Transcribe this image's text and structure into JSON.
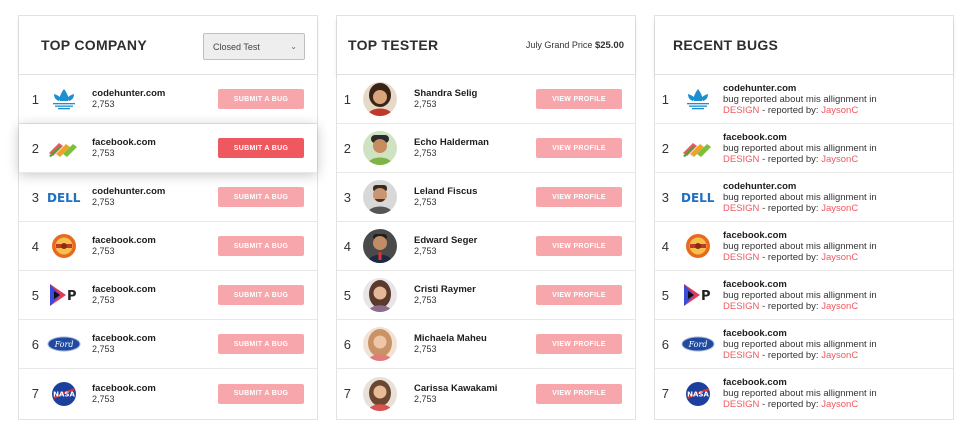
{
  "company": {
    "title": "TOP COMPANY",
    "filter": "Closed Test",
    "button_label": "SUBMIT A BUG",
    "rows": [
      {
        "rank": "1",
        "name": "codehunter.com",
        "count": "2,753",
        "logo": "adidas-logo-icon"
      },
      {
        "rank": "2",
        "name": "facebook.com",
        "count": "2,753",
        "logo": "stripes-logo-icon"
      },
      {
        "rank": "3",
        "name": "codehunter.com",
        "count": "2,753",
        "logo": "dell-logo-icon"
      },
      {
        "rank": "4",
        "name": "facebook.com",
        "count": "2,753",
        "logo": "badge-logo-icon"
      },
      {
        "rank": "5",
        "name": "facebook.com",
        "count": "2,753",
        "logo": "p-logo-icon"
      },
      {
        "rank": "6",
        "name": "facebook.com",
        "count": "2,753",
        "logo": "ford-logo-icon"
      },
      {
        "rank": "7",
        "name": "facebook.com",
        "count": "2,753",
        "logo": "nasa-logo-icon"
      }
    ]
  },
  "tester": {
    "title": "TOP TESTER",
    "prize_label": "July Grand Price",
    "prize_value": "$25.00",
    "button_label": "VIEW PROFILE",
    "rows": [
      {
        "rank": "1",
        "name": "Shandra Selig",
        "count": "2,753"
      },
      {
        "rank": "2",
        "name": "Echo Halderman",
        "count": "2,753"
      },
      {
        "rank": "3",
        "name": "Leland Fiscus",
        "count": "2,753"
      },
      {
        "rank": "4",
        "name": "Edward Seger",
        "count": "2,753"
      },
      {
        "rank": "5",
        "name": "Cristi Raymer",
        "count": "2,753"
      },
      {
        "rank": "6",
        "name": "Michaela Maheu",
        "count": "2,753"
      },
      {
        "rank": "7",
        "name": "Carissa Kawakami",
        "count": "2,753"
      }
    ]
  },
  "bugs": {
    "title": "RECENT BUGS",
    "rows": [
      {
        "rank": "1",
        "site": "codehunter.com",
        "text": "bug reported about mis allignment in",
        "tag": "DESIGN",
        "by": " - reported by: ",
        "reporter": "JaysonC"
      },
      {
        "rank": "2",
        "site": "facebook.com",
        "text": "bug reported about mis allignment in",
        "tag": "DESIGN",
        "by": " - reported by: ",
        "reporter": "JaysonC"
      },
      {
        "rank": "3",
        "site": "codehunter.com",
        "text": "bug reported about mis allignment in",
        "tag": "DESIGN",
        "by": " - reported by: ",
        "reporter": "JaysonC"
      },
      {
        "rank": "4",
        "site": "facebook.com",
        "text": "bug reported about mis allignment in",
        "tag": "DESIGN",
        "by": " - reported by: ",
        "reporter": "JaysonC"
      },
      {
        "rank": "5",
        "site": "facebook.com",
        "text": "bug reported about mis allignment in",
        "tag": "DESIGN",
        "by": " - reported by: ",
        "reporter": "JaysonC"
      },
      {
        "rank": "6",
        "site": "facebook.com",
        "text": "bug reported about mis allignment in",
        "tag": "DESIGN",
        "by": " - reported by: ",
        "reporter": "JaysonC"
      },
      {
        "rank": "7",
        "site": "facebook.com",
        "text": "bug reported about mis allignment in",
        "tag": "DESIGN",
        "by": " - reported by: ",
        "reporter": "JaysonC"
      }
    ]
  },
  "colors": {
    "accent": "#f0585f",
    "accent_light": "#f7a7ab"
  }
}
